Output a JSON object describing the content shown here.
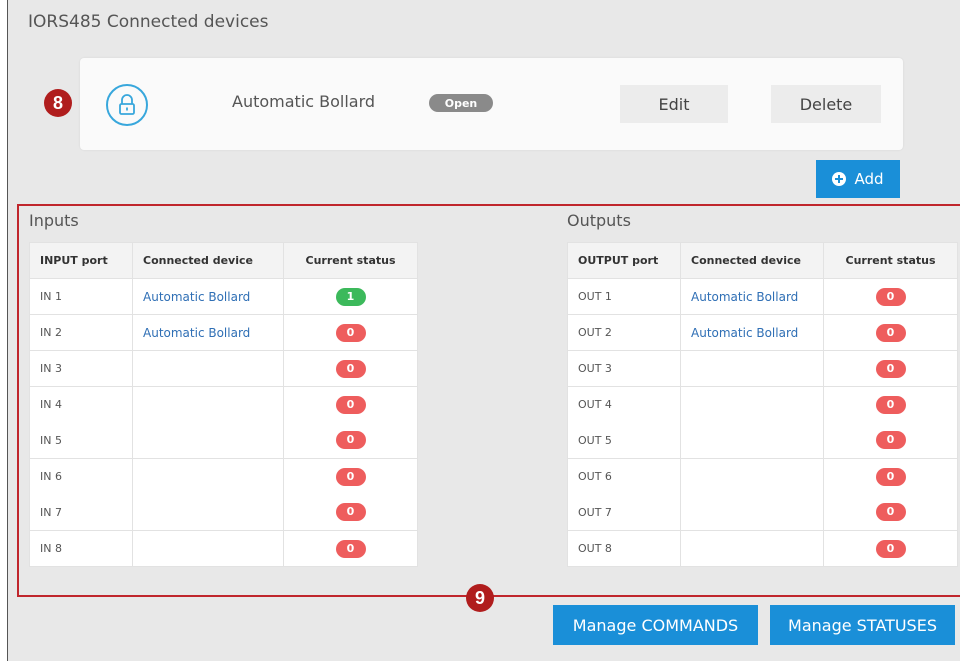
{
  "page": {
    "title": "IORS485 Connected devices"
  },
  "device": {
    "icon": "lock-icon",
    "name": "Automatic Bollard",
    "status": "Open",
    "edit_label": "Edit",
    "delete_label": "Delete"
  },
  "add_label": "Add",
  "callouts": {
    "device": "8",
    "io": "9"
  },
  "inputs": {
    "title": "Inputs",
    "headers": [
      "INPUT port",
      "Connected device",
      "Current status"
    ],
    "rows": [
      {
        "port": "IN 1",
        "device": "Automatic Bollard",
        "status": "1"
      },
      {
        "port": "IN 2",
        "device": "Automatic Bollard",
        "status": "0"
      },
      {
        "port": "IN 3",
        "device": "",
        "status": "0"
      },
      {
        "port": "IN 4",
        "device": "",
        "status": "0"
      },
      {
        "port": "IN 5",
        "device": "",
        "status": "0"
      },
      {
        "port": "IN 6",
        "device": "",
        "status": "0"
      },
      {
        "port": "IN 7",
        "device": "",
        "status": "0"
      },
      {
        "port": "IN 8",
        "device": "",
        "status": "0"
      }
    ]
  },
  "outputs": {
    "title": "Outputs",
    "headers": [
      "OUTPUT port",
      "Connected device",
      "Current status"
    ],
    "rows": [
      {
        "port": "OUT 1",
        "device": "Automatic Bollard",
        "status": "0"
      },
      {
        "port": "OUT 2",
        "device": "Automatic Bollard",
        "status": "0"
      },
      {
        "port": "OUT 3",
        "device": "",
        "status": "0"
      },
      {
        "port": "OUT 4",
        "device": "",
        "status": "0"
      },
      {
        "port": "OUT 5",
        "device": "",
        "status": "0"
      },
      {
        "port": "OUT 6",
        "device": "",
        "status": "0"
      },
      {
        "port": "OUT 7",
        "device": "",
        "status": "0"
      },
      {
        "port": "OUT 8",
        "device": "",
        "status": "0"
      }
    ]
  },
  "buttons": {
    "manage_commands": "Manage COMMANDS",
    "manage_statuses": "Manage STATUSES"
  },
  "colors": {
    "accent": "#1a8fd8",
    "status_on": "#3cb95b",
    "status_off": "#ee5d5d",
    "highlight": "#c0262c"
  }
}
